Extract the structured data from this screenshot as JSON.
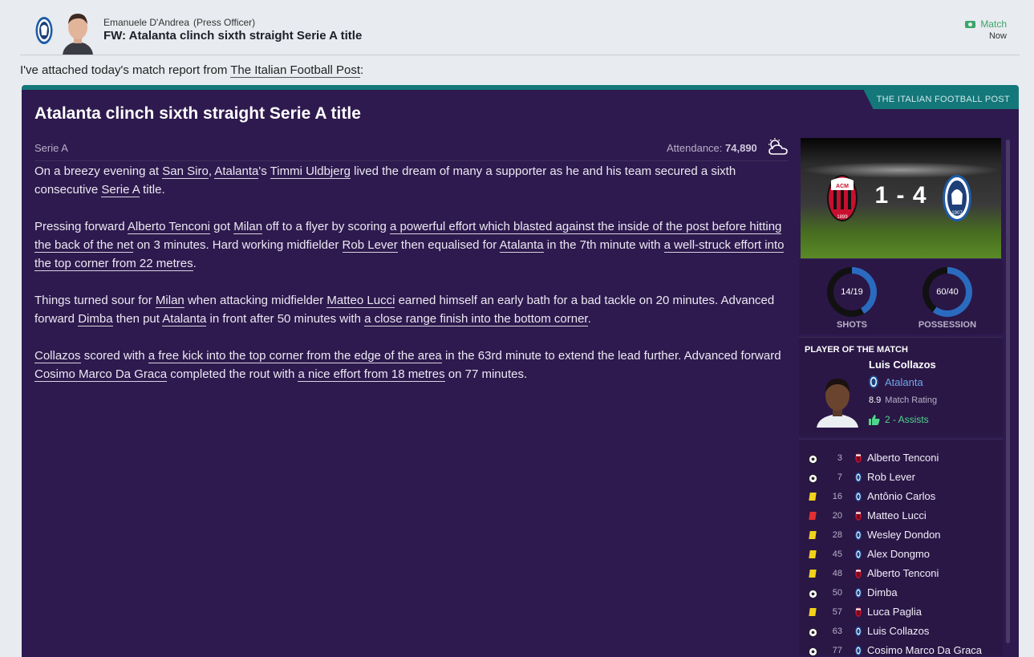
{
  "header": {
    "sender": "Emanuele D'Andrea",
    "role": "(Press Officer)",
    "subject": "FW: Atalanta clinch sixth straight Serie A title",
    "tag": "Match",
    "time": "Now"
  },
  "intro": {
    "text": "I've attached today's match report from ",
    "link": "The Italian Football Post",
    "suffix": ":"
  },
  "article": {
    "paper": "THE ITALIAN FOOTBALL POST",
    "headline": "Atalanta clinch sixth straight Serie A title",
    "competition": "Serie A",
    "attendance_label": "Attendance:",
    "attendance_value": "74,890",
    "weather": "partly-cloudy-icon"
  },
  "match": {
    "score": "1 - 4",
    "home": "AC Milan",
    "away": "Atalanta",
    "shots": "14/19",
    "shots_label": "SHOTS",
    "shots_home_fraction": 0.42,
    "possession": "60/40",
    "possession_label": "POSSESSION",
    "possession_home_fraction": 0.6
  },
  "potm": {
    "title": "PLAYER OF THE MATCH",
    "name": "Luis Collazos",
    "club": "Atalanta",
    "rating": "8.9",
    "rating_label": "Match Rating",
    "assists": "2 - Assists"
  },
  "events": [
    {
      "type": "goal",
      "minute": "3",
      "team": "milan",
      "player": "Alberto Tenconi"
    },
    {
      "type": "goal",
      "minute": "7",
      "team": "atalanta",
      "player": "Rob Lever"
    },
    {
      "type": "yellow",
      "minute": "16",
      "team": "atalanta",
      "player": "Antônio Carlos"
    },
    {
      "type": "red",
      "minute": "20",
      "team": "milan",
      "player": "Matteo Lucci"
    },
    {
      "type": "yellow",
      "minute": "28",
      "team": "atalanta",
      "player": "Wesley Dondon"
    },
    {
      "type": "yellow",
      "minute": "45",
      "team": "atalanta",
      "player": "Alex Dongmo"
    },
    {
      "type": "yellow",
      "minute": "48",
      "team": "milan",
      "player": "Alberto Tenconi"
    },
    {
      "type": "goal",
      "minute": "50",
      "team": "atalanta",
      "player": "Dimba"
    },
    {
      "type": "yellow",
      "minute": "57",
      "team": "milan",
      "player": "Luca Paglia"
    },
    {
      "type": "goal",
      "minute": "63",
      "team": "atalanta",
      "player": "Luis Collazos"
    },
    {
      "type": "goal",
      "minute": "77",
      "team": "atalanta",
      "player": "Cosimo Marco Da Graca"
    }
  ],
  "colors": {
    "panel": "#2e1a4e",
    "accent": "#14777a",
    "milan": "#c8102e",
    "atalanta": "#1e5aa8",
    "ring": "#2a6bbf"
  }
}
